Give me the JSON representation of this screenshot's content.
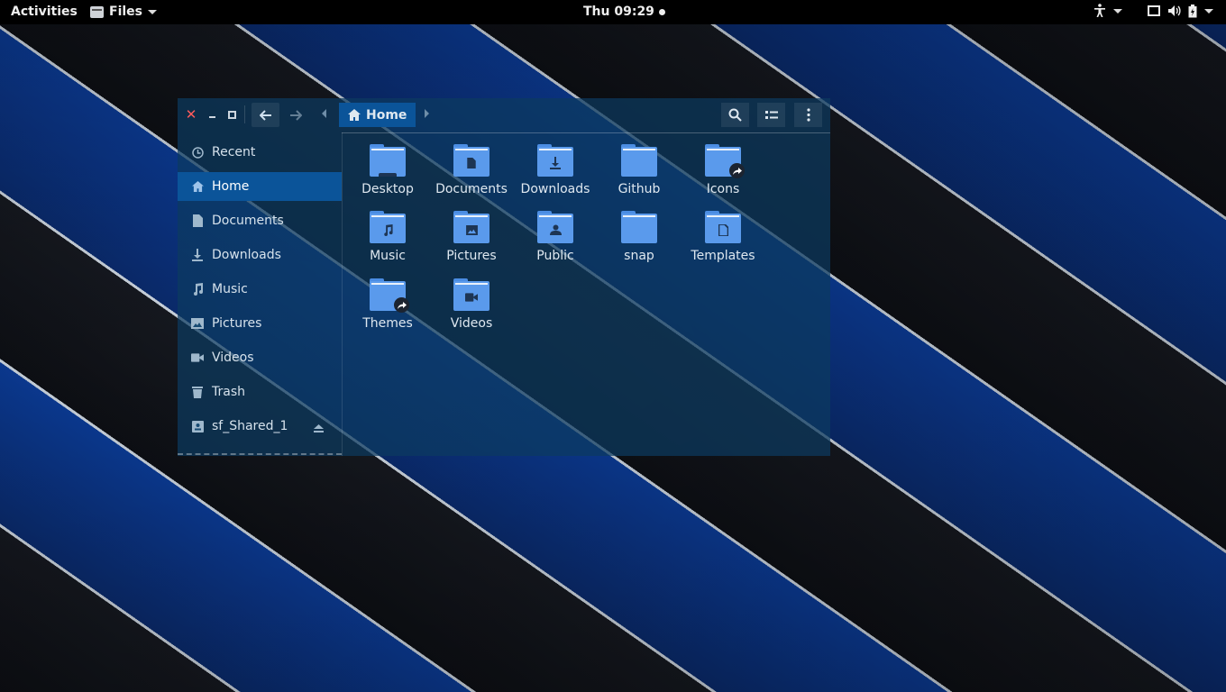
{
  "topbar": {
    "activities": "Activities",
    "app_name": "Files",
    "clock": "Thu 09:29"
  },
  "window": {
    "breadcrumb_home": "Home"
  },
  "sidebar": {
    "items": [
      {
        "label": "Recent",
        "icon": "clock-icon"
      },
      {
        "label": "Home",
        "icon": "home-icon",
        "active": true
      },
      {
        "label": "Documents",
        "icon": "document-icon"
      },
      {
        "label": "Downloads",
        "icon": "download-icon"
      },
      {
        "label": "Music",
        "icon": "music-icon"
      },
      {
        "label": "Pictures",
        "icon": "picture-icon"
      },
      {
        "label": "Videos",
        "icon": "video-icon"
      },
      {
        "label": "Trash",
        "icon": "trash-icon"
      },
      {
        "label": "sf_Shared_1",
        "icon": "drive-icon"
      }
    ]
  },
  "files": [
    {
      "name": "Desktop",
      "emblem": "desktop"
    },
    {
      "name": "Documents",
      "emblem": "document"
    },
    {
      "name": "Downloads",
      "emblem": "download"
    },
    {
      "name": "Github",
      "emblem": "none"
    },
    {
      "name": "Icons",
      "emblem": "link"
    },
    {
      "name": "Music",
      "emblem": "music"
    },
    {
      "name": "Pictures",
      "emblem": "picture"
    },
    {
      "name": "Public",
      "emblem": "person"
    },
    {
      "name": "snap",
      "emblem": "none"
    },
    {
      "name": "Templates",
      "emblem": "template"
    },
    {
      "name": "Themes",
      "emblem": "link"
    },
    {
      "name": "Videos",
      "emblem": "video"
    }
  ],
  "colors": {
    "accent": "#0b5499",
    "folder": "#5a9aec",
    "close": "#ff5b5b"
  }
}
